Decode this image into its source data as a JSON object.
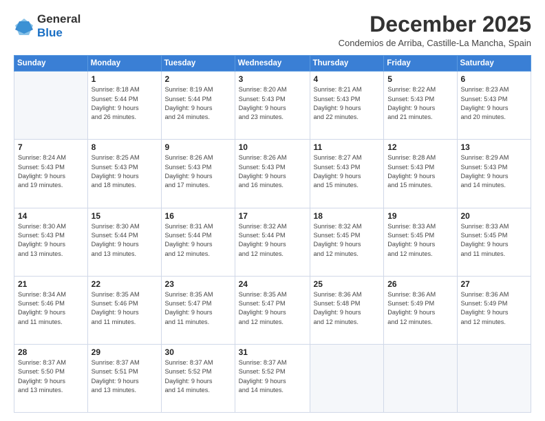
{
  "logo": {
    "general": "General",
    "blue": "Blue",
    "aria": "GeneralBlue logo"
  },
  "title": "December 2025",
  "subtitle": "Condemios de Arriba, Castille-La Mancha, Spain",
  "weekdays": [
    "Sunday",
    "Monday",
    "Tuesday",
    "Wednesday",
    "Thursday",
    "Friday",
    "Saturday"
  ],
  "weeks": [
    [
      {
        "day": "",
        "info": ""
      },
      {
        "day": "1",
        "info": "Sunrise: 8:18 AM\nSunset: 5:44 PM\nDaylight: 9 hours\nand 26 minutes."
      },
      {
        "day": "2",
        "info": "Sunrise: 8:19 AM\nSunset: 5:44 PM\nDaylight: 9 hours\nand 24 minutes."
      },
      {
        "day": "3",
        "info": "Sunrise: 8:20 AM\nSunset: 5:43 PM\nDaylight: 9 hours\nand 23 minutes."
      },
      {
        "day": "4",
        "info": "Sunrise: 8:21 AM\nSunset: 5:43 PM\nDaylight: 9 hours\nand 22 minutes."
      },
      {
        "day": "5",
        "info": "Sunrise: 8:22 AM\nSunset: 5:43 PM\nDaylight: 9 hours\nand 21 minutes."
      },
      {
        "day": "6",
        "info": "Sunrise: 8:23 AM\nSunset: 5:43 PM\nDaylight: 9 hours\nand 20 minutes."
      }
    ],
    [
      {
        "day": "7",
        "info": "Sunrise: 8:24 AM\nSunset: 5:43 PM\nDaylight: 9 hours\nand 19 minutes."
      },
      {
        "day": "8",
        "info": "Sunrise: 8:25 AM\nSunset: 5:43 PM\nDaylight: 9 hours\nand 18 minutes."
      },
      {
        "day": "9",
        "info": "Sunrise: 8:26 AM\nSunset: 5:43 PM\nDaylight: 9 hours\nand 17 minutes."
      },
      {
        "day": "10",
        "info": "Sunrise: 8:26 AM\nSunset: 5:43 PM\nDaylight: 9 hours\nand 16 minutes."
      },
      {
        "day": "11",
        "info": "Sunrise: 8:27 AM\nSunset: 5:43 PM\nDaylight: 9 hours\nand 15 minutes."
      },
      {
        "day": "12",
        "info": "Sunrise: 8:28 AM\nSunset: 5:43 PM\nDaylight: 9 hours\nand 15 minutes."
      },
      {
        "day": "13",
        "info": "Sunrise: 8:29 AM\nSunset: 5:43 PM\nDaylight: 9 hours\nand 14 minutes."
      }
    ],
    [
      {
        "day": "14",
        "info": "Sunrise: 8:30 AM\nSunset: 5:43 PM\nDaylight: 9 hours\nand 13 minutes."
      },
      {
        "day": "15",
        "info": "Sunrise: 8:30 AM\nSunset: 5:44 PM\nDaylight: 9 hours\nand 13 minutes."
      },
      {
        "day": "16",
        "info": "Sunrise: 8:31 AM\nSunset: 5:44 PM\nDaylight: 9 hours\nand 12 minutes."
      },
      {
        "day": "17",
        "info": "Sunrise: 8:32 AM\nSunset: 5:44 PM\nDaylight: 9 hours\nand 12 minutes."
      },
      {
        "day": "18",
        "info": "Sunrise: 8:32 AM\nSunset: 5:45 PM\nDaylight: 9 hours\nand 12 minutes."
      },
      {
        "day": "19",
        "info": "Sunrise: 8:33 AM\nSunset: 5:45 PM\nDaylight: 9 hours\nand 12 minutes."
      },
      {
        "day": "20",
        "info": "Sunrise: 8:33 AM\nSunset: 5:45 PM\nDaylight: 9 hours\nand 11 minutes."
      }
    ],
    [
      {
        "day": "21",
        "info": "Sunrise: 8:34 AM\nSunset: 5:46 PM\nDaylight: 9 hours\nand 11 minutes."
      },
      {
        "day": "22",
        "info": "Sunrise: 8:35 AM\nSunset: 5:46 PM\nDaylight: 9 hours\nand 11 minutes."
      },
      {
        "day": "23",
        "info": "Sunrise: 8:35 AM\nSunset: 5:47 PM\nDaylight: 9 hours\nand 11 minutes."
      },
      {
        "day": "24",
        "info": "Sunrise: 8:35 AM\nSunset: 5:47 PM\nDaylight: 9 hours\nand 12 minutes."
      },
      {
        "day": "25",
        "info": "Sunrise: 8:36 AM\nSunset: 5:48 PM\nDaylight: 9 hours\nand 12 minutes."
      },
      {
        "day": "26",
        "info": "Sunrise: 8:36 AM\nSunset: 5:49 PM\nDaylight: 9 hours\nand 12 minutes."
      },
      {
        "day": "27",
        "info": "Sunrise: 8:36 AM\nSunset: 5:49 PM\nDaylight: 9 hours\nand 12 minutes."
      }
    ],
    [
      {
        "day": "28",
        "info": "Sunrise: 8:37 AM\nSunset: 5:50 PM\nDaylight: 9 hours\nand 13 minutes."
      },
      {
        "day": "29",
        "info": "Sunrise: 8:37 AM\nSunset: 5:51 PM\nDaylight: 9 hours\nand 13 minutes."
      },
      {
        "day": "30",
        "info": "Sunrise: 8:37 AM\nSunset: 5:52 PM\nDaylight: 9 hours\nand 14 minutes."
      },
      {
        "day": "31",
        "info": "Sunrise: 8:37 AM\nSunset: 5:52 PM\nDaylight: 9 hours\nand 14 minutes."
      },
      {
        "day": "",
        "info": ""
      },
      {
        "day": "",
        "info": ""
      },
      {
        "day": "",
        "info": ""
      }
    ]
  ]
}
